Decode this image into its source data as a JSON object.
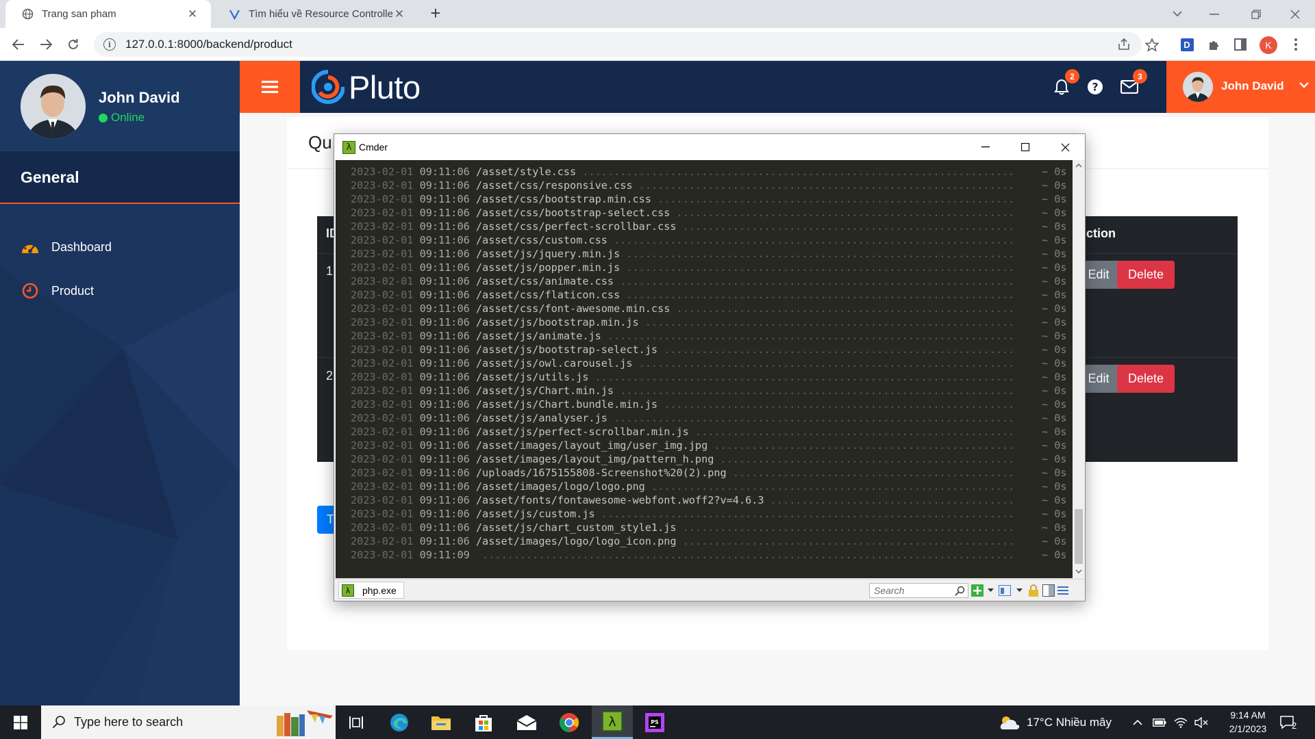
{
  "browser": {
    "tabs": [
      {
        "title": "Trang san pham",
        "active": true,
        "icon": "globe-icon"
      },
      {
        "title": "Tìm hiểu về Resource Controller t",
        "active": false,
        "icon": "viblo-icon"
      }
    ],
    "new_tab": "+",
    "url": "127.0.0.1:8000/backend/product",
    "profile_initial": "K",
    "extension_label": "D"
  },
  "sidebar": {
    "user_name": "John David",
    "user_status": "Online",
    "section_title": "General",
    "items": [
      {
        "label": "Dashboard",
        "icon": "dashboard-gauge-icon",
        "icon_color": "#ff9800"
      },
      {
        "label": "Product",
        "icon": "clock-icon",
        "icon_color": "#ff5722"
      }
    ]
  },
  "topnav": {
    "logo_text": "Pluto",
    "notifications_count": "2",
    "messages_count": "3",
    "user_name": "John David"
  },
  "main": {
    "page_title_visible": "Qu",
    "table": {
      "header_id_visible": "ID",
      "header_action_visible": "ction",
      "rows": [
        {
          "id": "1",
          "edit": "Edit",
          "delete": "Delete"
        },
        {
          "id": "2",
          "edit": "Edit",
          "delete": "Delete"
        }
      ]
    },
    "add_button_visible": "T"
  },
  "cmder": {
    "title": "Cmder",
    "tab_label": "php.exe",
    "search_placeholder": "Search",
    "log": [
      {
        "date": "2023-02-01",
        "time": "09:11:06",
        "path": "/asset/style.css",
        "dur": "~ 0s"
      },
      {
        "date": "2023-02-01",
        "time": "09:11:06",
        "path": "/asset/css/responsive.css",
        "dur": "~ 0s"
      },
      {
        "date": "2023-02-01",
        "time": "09:11:06",
        "path": "/asset/css/bootstrap.min.css",
        "dur": "~ 0s"
      },
      {
        "date": "2023-02-01",
        "time": "09:11:06",
        "path": "/asset/css/bootstrap-select.css",
        "dur": "~ 0s"
      },
      {
        "date": "2023-02-01",
        "time": "09:11:06",
        "path": "/asset/css/perfect-scrollbar.css",
        "dur": "~ 0s"
      },
      {
        "date": "2023-02-01",
        "time": "09:11:06",
        "path": "/asset/css/custom.css",
        "dur": "~ 0s"
      },
      {
        "date": "2023-02-01",
        "time": "09:11:06",
        "path": "/asset/js/jquery.min.js",
        "dur": "~ 0s"
      },
      {
        "date": "2023-02-01",
        "time": "09:11:06",
        "path": "/asset/js/popper.min.js",
        "dur": "~ 0s"
      },
      {
        "date": "2023-02-01",
        "time": "09:11:06",
        "path": "/asset/css/animate.css",
        "dur": "~ 0s"
      },
      {
        "date": "2023-02-01",
        "time": "09:11:06",
        "path": "/asset/css/flaticon.css",
        "dur": "~ 0s"
      },
      {
        "date": "2023-02-01",
        "time": "09:11:06",
        "path": "/asset/css/font-awesome.min.css",
        "dur": "~ 0s"
      },
      {
        "date": "2023-02-01",
        "time": "09:11:06",
        "path": "/asset/js/bootstrap.min.js",
        "dur": "~ 0s"
      },
      {
        "date": "2023-02-01",
        "time": "09:11:06",
        "path": "/asset/js/animate.js",
        "dur": "~ 0s"
      },
      {
        "date": "2023-02-01",
        "time": "09:11:06",
        "path": "/asset/js/bootstrap-select.js",
        "dur": "~ 0s"
      },
      {
        "date": "2023-02-01",
        "time": "09:11:06",
        "path": "/asset/js/owl.carousel.js",
        "dur": "~ 0s"
      },
      {
        "date": "2023-02-01",
        "time": "09:11:06",
        "path": "/asset/js/utils.js",
        "dur": "~ 0s"
      },
      {
        "date": "2023-02-01",
        "time": "09:11:06",
        "path": "/asset/js/Chart.min.js",
        "dur": "~ 0s"
      },
      {
        "date": "2023-02-01",
        "time": "09:11:06",
        "path": "/asset/js/Chart.bundle.min.js",
        "dur": "~ 0s"
      },
      {
        "date": "2023-02-01",
        "time": "09:11:06",
        "path": "/asset/js/analyser.js",
        "dur": "~ 0s"
      },
      {
        "date": "2023-02-01",
        "time": "09:11:06",
        "path": "/asset/js/perfect-scrollbar.min.js",
        "dur": "~ 0s"
      },
      {
        "date": "2023-02-01",
        "time": "09:11:06",
        "path": "/asset/images/layout_img/user_img.jpg",
        "dur": "~ 0s"
      },
      {
        "date": "2023-02-01",
        "time": "09:11:06",
        "path": "/asset/images/layout_img/pattern_h.png",
        "dur": "~ 0s"
      },
      {
        "date": "2023-02-01",
        "time": "09:11:06",
        "path": "/uploads/1675155808-Screenshot%20(2).png",
        "dur": "~ 0s"
      },
      {
        "date": "2023-02-01",
        "time": "09:11:06",
        "path": "/asset/images/logo/logo.png",
        "dur": "~ 0s"
      },
      {
        "date": "2023-02-01",
        "time": "09:11:06",
        "path": "/asset/fonts/fontawesome-webfont.woff2?v=4.6.3",
        "dur": "~ 0s"
      },
      {
        "date": "2023-02-01",
        "time": "09:11:06",
        "path": "/asset/js/custom.js",
        "dur": "~ 0s"
      },
      {
        "date": "2023-02-01",
        "time": "09:11:06",
        "path": "/asset/js/chart_custom_style1.js",
        "dur": "~ 0s"
      },
      {
        "date": "2023-02-01",
        "time": "09:11:06",
        "path": "/asset/images/logo/logo_icon.png",
        "dur": "~ 0s"
      },
      {
        "date": "2023-02-01",
        "time": "09:11:09",
        "path": "",
        "dur": "~ 0s"
      }
    ]
  },
  "taskbar": {
    "search_placeholder": "Type here to search",
    "weather": "17°C  Nhiều mây",
    "time": "9:14 AM",
    "date": "2/1/2023",
    "notifications": "2"
  },
  "colors": {
    "accent": "#ff5722",
    "sidebar_bg": "#1c355e",
    "topnav_bg": "#14294b",
    "danger": "#dc3545",
    "secondary": "#6c757d",
    "console_bg": "#272822"
  }
}
